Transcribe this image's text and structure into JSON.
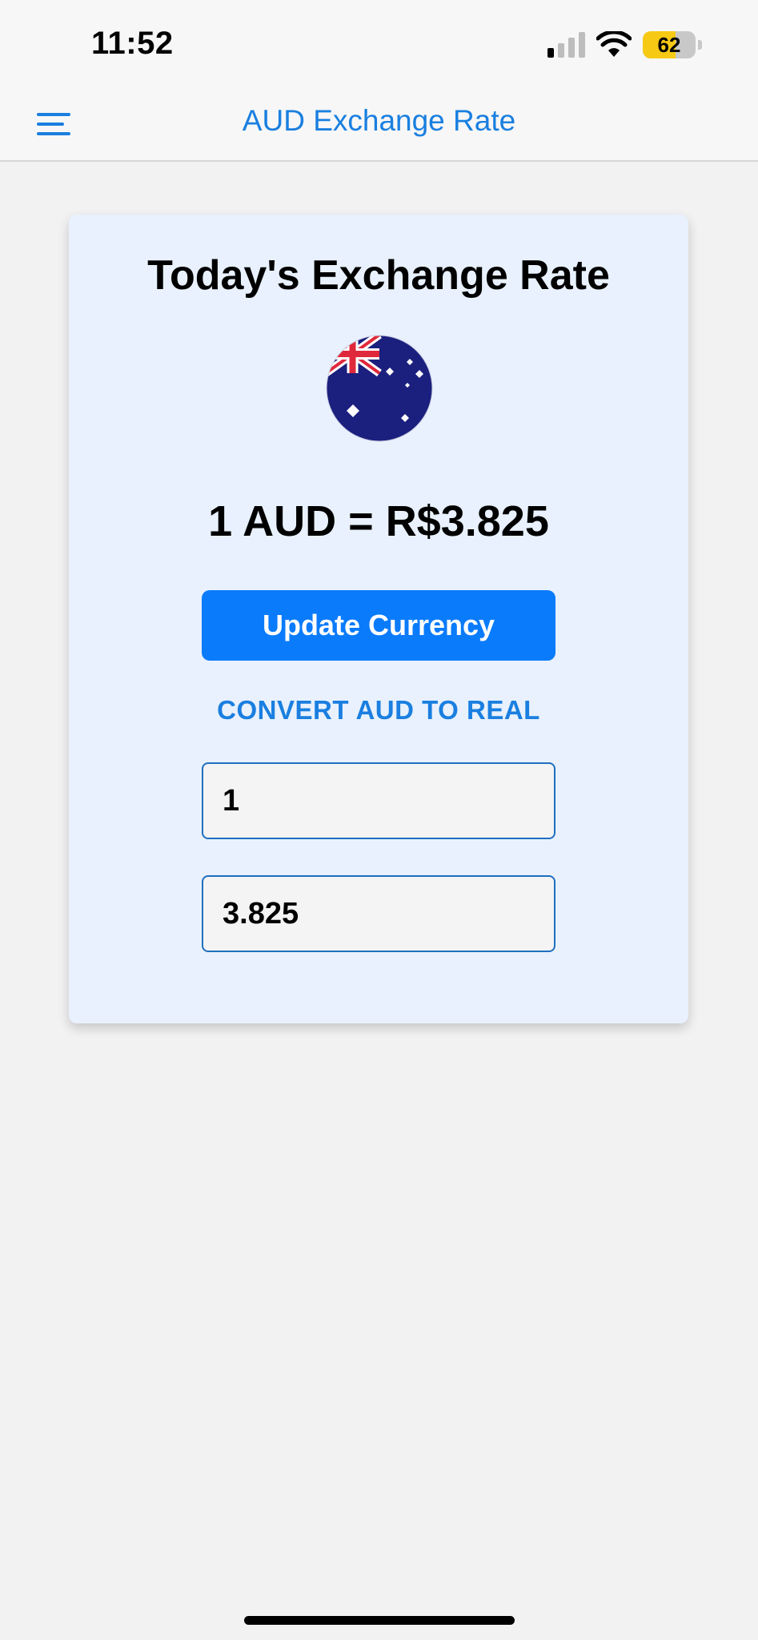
{
  "status_bar": {
    "time": "11:52",
    "battery_level": 62,
    "battery_text": "62",
    "battery_color": "#f6c915",
    "signal_bars_active": 1,
    "icons": [
      "cellular-signal-icon",
      "wifi-icon",
      "battery-icon"
    ]
  },
  "nav": {
    "title": "AUD Exchange Rate",
    "menu_icon": "hamburger-menu-icon",
    "accent_color": "#1a7fe0"
  },
  "card": {
    "title": "Today's Exchange Rate",
    "flag_icon": "australia-flag-icon",
    "rate_text": "1 AUD = R$3.825",
    "update_button_label": "Update Currency",
    "convert_label": "CONVERT AUD TO REAL",
    "aud_value": "1",
    "brl_value": "3.825",
    "button_color": "#0a7bfb"
  }
}
